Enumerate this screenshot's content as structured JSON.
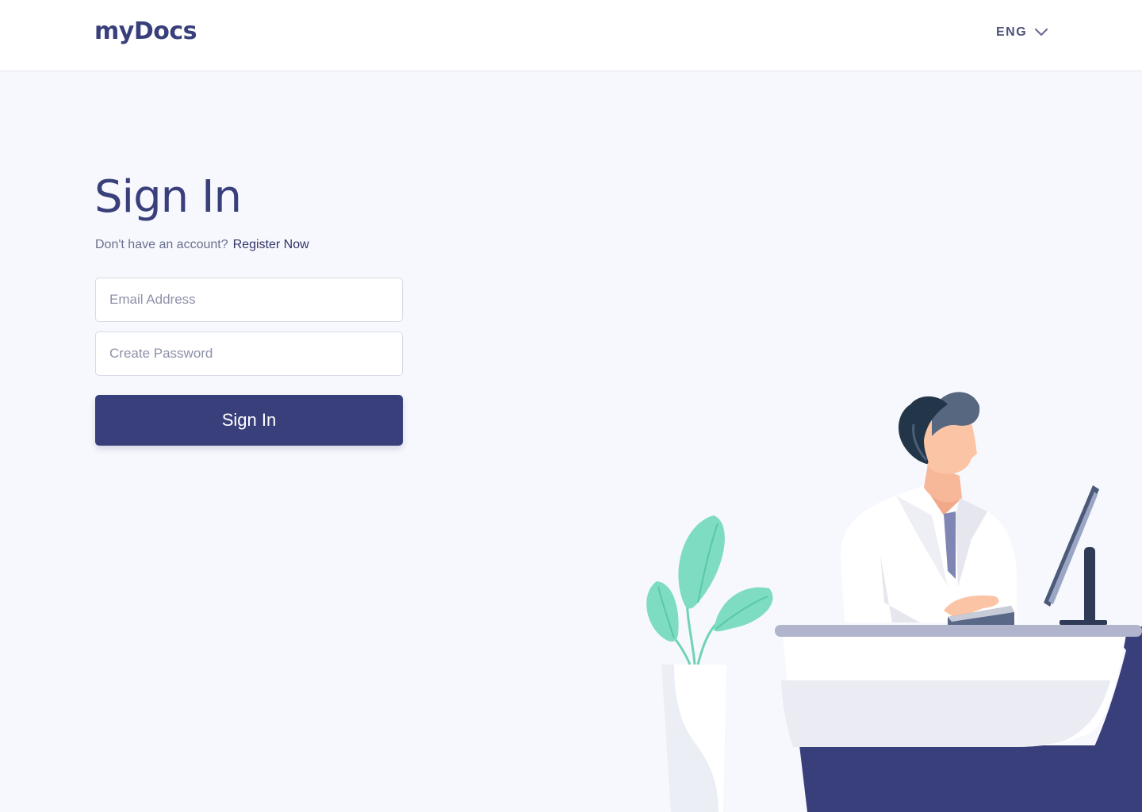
{
  "header": {
    "logo": "myDocs",
    "language": {
      "selected": "ENG",
      "icon": "chevron-down-icon"
    }
  },
  "signin": {
    "title": "Sign In",
    "prompt": "Don't have an account?",
    "register_link": "Register Now",
    "email_placeholder": "Email Address",
    "password_placeholder": "Create Password",
    "button_label": "Sign In"
  },
  "colors": {
    "brand": "#393f7b",
    "background": "#f7f8fd",
    "plant_leaf": "#7ddcc1",
    "desk_accent": "#393f7b"
  }
}
